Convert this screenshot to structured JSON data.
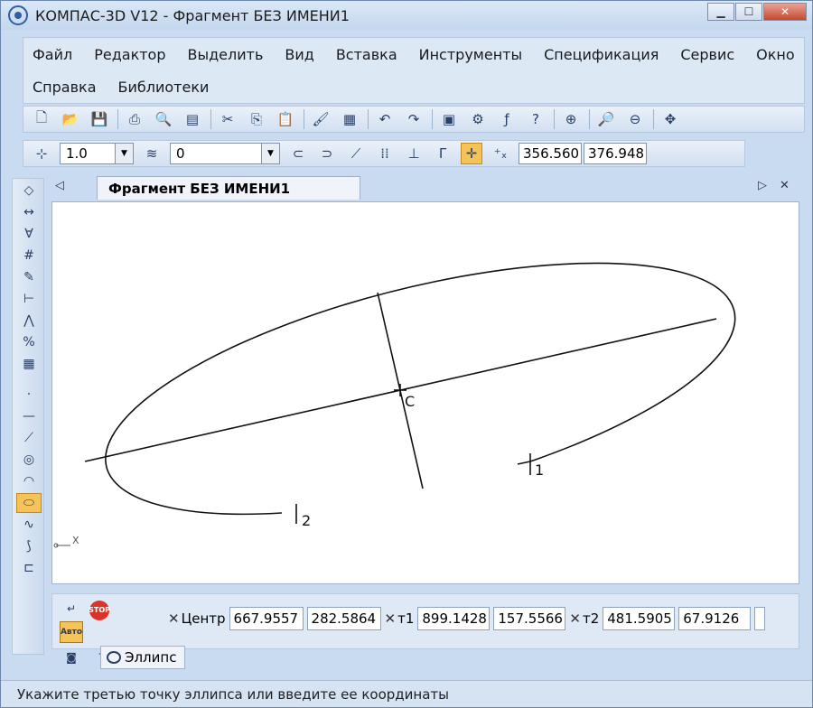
{
  "window": {
    "title": "КОМПАС-3D V12 - Фрагмент БЕЗ ИМЕНИ1",
    "minimize_icon": "minimize-icon",
    "maximize_icon": "maximize-icon",
    "close_icon": "close-icon"
  },
  "menu": {
    "row1": [
      "Файл",
      "Редактор",
      "Выделить",
      "Вид",
      "Вставка",
      "Инструменты",
      "Спецификация",
      "Сервис",
      "Окно"
    ],
    "row2": [
      "Справка",
      "Библиотеки"
    ]
  },
  "toolbar2": {
    "step_value": "1.0",
    "layer_value": "0",
    "cursor_x": "356.560",
    "cursor_y": "376.948"
  },
  "document": {
    "tab_title": "Фрагмент БЕЗ ИМЕНИ1"
  },
  "canvas": {
    "center_label": "C",
    "point1_label": "1",
    "point2_label": "2",
    "axis_label": "X"
  },
  "properties": {
    "center_label": "Центр",
    "center_x": "667.9557",
    "center_y": "282.5864",
    "t1_label": "т1",
    "t1_x": "899.1428",
    "t1_y": "157.5566",
    "t2_label": "т2",
    "t2_x": "481.5905",
    "t2_y": "67.9126",
    "stop_label": "STOP",
    "auto_label": "Авто",
    "tab_label": "Эллипс"
  },
  "status": {
    "text": "Укажите третью точку эллипса или введите ее координаты"
  }
}
